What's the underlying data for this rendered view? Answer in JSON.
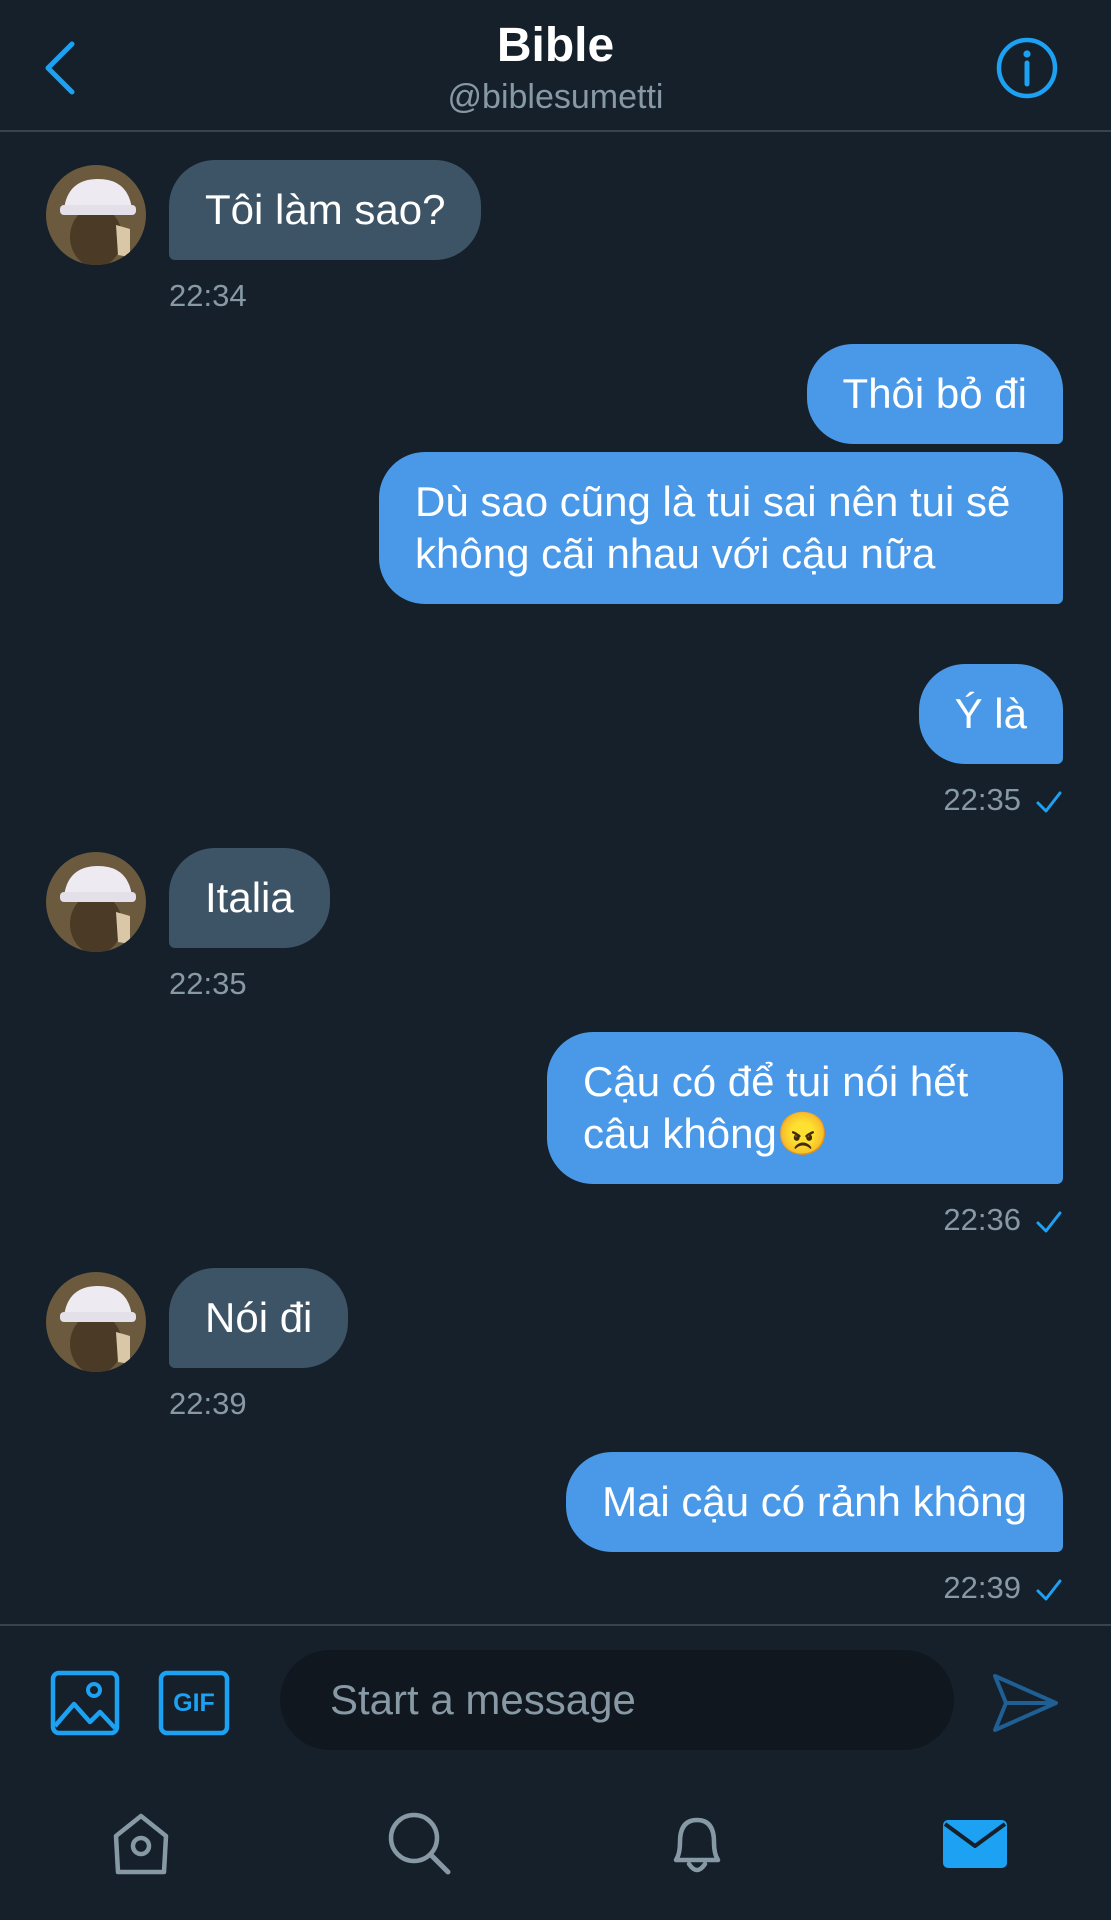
{
  "header": {
    "title": "Bible",
    "handle": "@biblesumetti"
  },
  "colors": {
    "background": "#15202b",
    "accent": "#1da1f2",
    "outgoing_bubble": "#4a99e9",
    "incoming_bubble": "#3d5466",
    "muted_text": "#8899a6"
  },
  "messages": {
    "m1": {
      "text": "Tôi làm sao?",
      "time": "22:34"
    },
    "m2": {
      "text": "Thôi bỏ đi"
    },
    "m3": {
      "text": "Dù sao cũng là tui sai nên tui sẽ không cãi nhau với cậu nữa"
    },
    "m4": {
      "text": "Ý là",
      "time": "22:35"
    },
    "m5": {
      "text": "Italia",
      "time": "22:35"
    },
    "m6": {
      "text": "Cậu có để tui nói hết câu không😠",
      "time": "22:36"
    },
    "m7": {
      "text": "Nói đi",
      "time": "22:39"
    },
    "m8": {
      "text": "Mai cậu có rảnh không",
      "time": "22:39"
    }
  },
  "composer": {
    "placeholder": "Start a message",
    "gif_label": "GIF"
  },
  "icons": {
    "back": "chevron-left-icon",
    "info": "info-circle-icon",
    "media": "image-icon",
    "gif": "gif-icon",
    "send": "send-icon",
    "home": "home-icon",
    "search": "search-icon",
    "notifications": "bell-icon",
    "messages": "mail-icon"
  }
}
